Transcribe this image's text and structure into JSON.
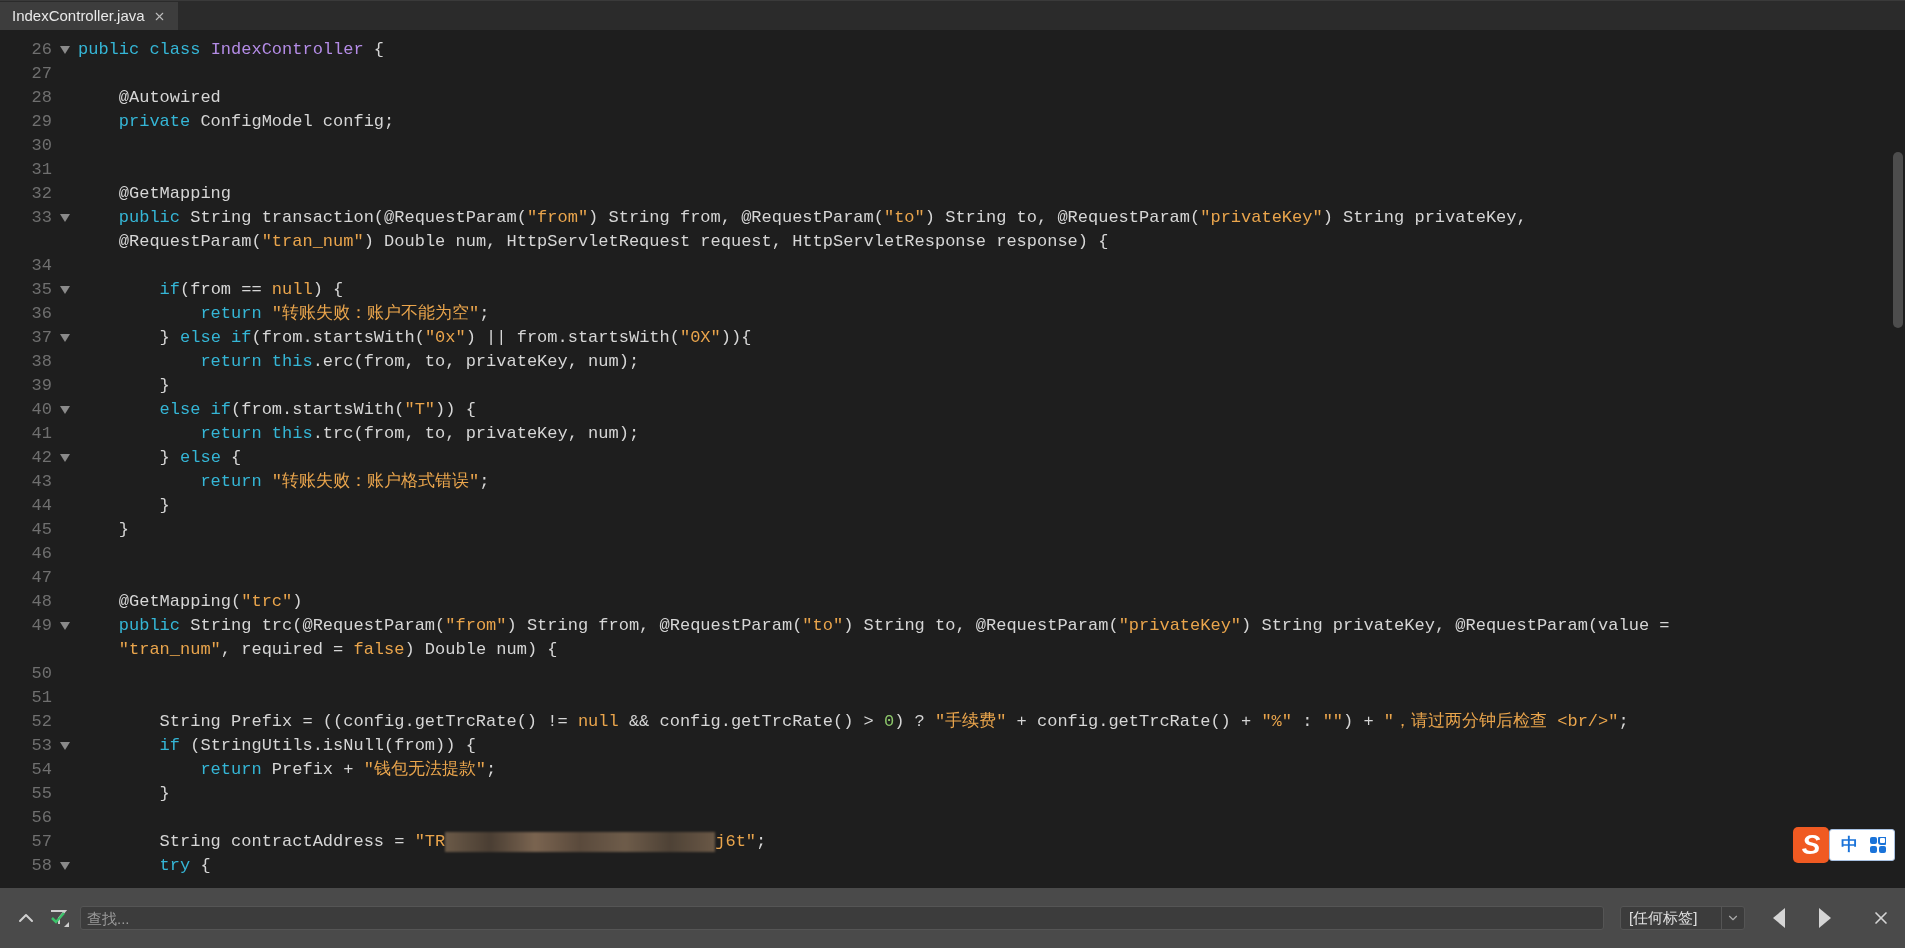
{
  "tabs": [
    {
      "label": "IndexController.java",
      "selected": true
    }
  ],
  "lines": [
    {
      "number": "26",
      "fold": true,
      "tokens": [
        {
          "kind": "keyword",
          "text": "public"
        },
        {
          "kind": "keyword",
          "text": " class"
        },
        {
          "kind": "class-name",
          "text": " IndexController"
        },
        {
          "kind": "plain",
          "text": " {"
        }
      ]
    },
    {
      "number": "27",
      "fold": false
    },
    {
      "number": "28",
      "fold": false,
      "tokens": [
        {
          "kind": "plain",
          "text": "    @Autowired"
        }
      ]
    },
    {
      "number": "29",
      "fold": false,
      "tokens": [
        {
          "kind": "keyword",
          "text": "    private"
        },
        {
          "kind": "plain",
          "text": " ConfigModel config;"
        }
      ]
    },
    {
      "number": "30",
      "fold": false
    },
    {
      "number": "31",
      "fold": false
    },
    {
      "number": "32",
      "fold": false,
      "tokens": [
        {
          "kind": "plain",
          "text": "    @GetMapping"
        }
      ]
    },
    {
      "number": "33",
      "fold": true,
      "tokens": [
        {
          "kind": "keyword",
          "text": "    public"
        },
        {
          "kind": "plain",
          "text": " String transaction(@RequestParam("
        },
        {
          "kind": "string",
          "text": "\"from\""
        },
        {
          "kind": "plain",
          "text": ") String from, @RequestParam("
        },
        {
          "kind": "string",
          "text": "\"to\""
        },
        {
          "kind": "plain",
          "text": ") String to, @RequestParam("
        },
        {
          "kind": "string",
          "text": "\"privateKey\""
        },
        {
          "kind": "plain",
          "text": ") String privateKey,"
        }
      ]
    },
    {
      "fold": false,
      "tokens": [
        {
          "kind": "plain",
          "text": "    @RequestParam("
        },
        {
          "kind": "string",
          "text": "\"tran_num\""
        },
        {
          "kind": "plain",
          "text": ") Double num, HttpServletRequest request, HttpServletResponse response) {"
        }
      ]
    },
    {
      "number": "34",
      "fold": false
    },
    {
      "number": "35",
      "fold": true,
      "tokens": [
        {
          "kind": "keyword",
          "text": "        if"
        },
        {
          "kind": "plain",
          "text": "(from == "
        },
        {
          "kind": "literal",
          "text": "null"
        },
        {
          "kind": "plain",
          "text": ") {"
        }
      ]
    },
    {
      "number": "36",
      "fold": false,
      "tokens": [
        {
          "kind": "keyword",
          "text": "            return"
        },
        {
          "kind": "string",
          "text": " \"转账失败：账户不能为空\""
        },
        {
          "kind": "plain",
          "text": ";"
        }
      ]
    },
    {
      "number": "37",
      "fold": true,
      "tokens": [
        {
          "kind": "plain",
          "text": "        } "
        },
        {
          "kind": "keyword",
          "text": "else if"
        },
        {
          "kind": "plain",
          "text": "(from.startsWith("
        },
        {
          "kind": "string",
          "text": "\"0x\""
        },
        {
          "kind": "plain",
          "text": ") || from.startsWith("
        },
        {
          "kind": "string",
          "text": "\"0X\""
        },
        {
          "kind": "plain",
          "text": ")){"
        }
      ]
    },
    {
      "number": "38",
      "fold": false,
      "tokens": [
        {
          "kind": "keyword",
          "text": "            return this"
        },
        {
          "kind": "plain",
          "text": ".erc(from, to, privateKey, num);"
        }
      ]
    },
    {
      "number": "39",
      "fold": false,
      "tokens": [
        {
          "kind": "plain",
          "text": "        }"
        }
      ]
    },
    {
      "number": "40",
      "fold": true,
      "tokens": [
        {
          "kind": "keyword",
          "text": "        else if"
        },
        {
          "kind": "plain",
          "text": "(from.startsWith("
        },
        {
          "kind": "string",
          "text": "\"T\""
        },
        {
          "kind": "plain",
          "text": ")) {"
        }
      ]
    },
    {
      "number": "41",
      "fold": false,
      "tokens": [
        {
          "kind": "keyword",
          "text": "            return this"
        },
        {
          "kind": "plain",
          "text": ".trc(from, to, privateKey, num);"
        }
      ]
    },
    {
      "number": "42",
      "fold": true,
      "tokens": [
        {
          "kind": "plain",
          "text": "        } "
        },
        {
          "kind": "keyword",
          "text": "else"
        },
        {
          "kind": "plain",
          "text": " {"
        }
      ]
    },
    {
      "number": "43",
      "fold": false,
      "tokens": [
        {
          "kind": "keyword",
          "text": "            return"
        },
        {
          "kind": "string",
          "text": " \"转账失败：账户格式错误\""
        },
        {
          "kind": "plain",
          "text": ";"
        }
      ]
    },
    {
      "number": "44",
      "fold": false,
      "tokens": [
        {
          "kind": "plain",
          "text": "        }"
        }
      ]
    },
    {
      "number": "45",
      "fold": false,
      "tokens": [
        {
          "kind": "plain",
          "text": "    }"
        }
      ]
    },
    {
      "number": "46",
      "fold": false
    },
    {
      "number": "47",
      "fold": false
    },
    {
      "number": "48",
      "fold": false,
      "tokens": [
        {
          "kind": "plain",
          "text": "    @GetMapping("
        },
        {
          "kind": "string",
          "text": "\"trc\""
        },
        {
          "kind": "plain",
          "text": ")"
        }
      ]
    },
    {
      "number": "49",
      "fold": true,
      "tokens": [
        {
          "kind": "keyword",
          "text": "    public"
        },
        {
          "kind": "plain",
          "text": " String trc(@RequestParam("
        },
        {
          "kind": "string",
          "text": "\"from\""
        },
        {
          "kind": "plain",
          "text": ") String from, @RequestParam("
        },
        {
          "kind": "string",
          "text": "\"to\""
        },
        {
          "kind": "plain",
          "text": ") String to, @RequestParam("
        },
        {
          "kind": "string",
          "text": "\"privateKey\""
        },
        {
          "kind": "plain",
          "text": ") String privateKey, @RequestParam(value ="
        }
      ]
    },
    {
      "fold": false,
      "tokens": [
        {
          "kind": "string",
          "text": "    \"tran_num\""
        },
        {
          "kind": "plain",
          "text": ", required = "
        },
        {
          "kind": "literal",
          "text": "false"
        },
        {
          "kind": "plain",
          "text": ") Double num) {"
        }
      ]
    },
    {
      "number": "50",
      "fold": false
    },
    {
      "number": "51",
      "fold": false
    },
    {
      "number": "52",
      "fold": false,
      "tokens": [
        {
          "kind": "plain",
          "text": "        String Prefix = ((config.getTrcRate() != "
        },
        {
          "kind": "literal",
          "text": "null"
        },
        {
          "kind": "plain",
          "text": " && config.getTrcRate() > "
        },
        {
          "kind": "number",
          "text": "0"
        },
        {
          "kind": "plain",
          "text": ") ? "
        },
        {
          "kind": "string",
          "text": "\"手续费\""
        },
        {
          "kind": "plain",
          "text": " + config.getTrcRate() + "
        },
        {
          "kind": "string",
          "text": "\"%\""
        },
        {
          "kind": "plain",
          "text": " : "
        },
        {
          "kind": "string",
          "text": "\"\""
        },
        {
          "kind": "plain",
          "text": ") + "
        },
        {
          "kind": "string",
          "text": "\"，请过两分钟后检查 <br/>\""
        },
        {
          "kind": "plain",
          "text": ";"
        }
      ]
    },
    {
      "number": "53",
      "fold": true,
      "tokens": [
        {
          "kind": "keyword",
          "text": "        if"
        },
        {
          "kind": "plain",
          "text": " (StringUtils.isNull(from)) {"
        }
      ]
    },
    {
      "number": "54",
      "fold": false,
      "tokens": [
        {
          "kind": "keyword",
          "text": "            return"
        },
        {
          "kind": "plain",
          "text": " Prefix + "
        },
        {
          "kind": "string",
          "text": "\"钱包无法提款\""
        },
        {
          "kind": "plain",
          "text": ";"
        }
      ]
    },
    {
      "number": "55",
      "fold": false,
      "tokens": [
        {
          "kind": "plain",
          "text": "        }"
        }
      ]
    },
    {
      "number": "56",
      "fold": false
    },
    {
      "number": "57",
      "fold": false,
      "tokens": [
        {
          "kind": "plain",
          "text": "        String contractAddress = "
        },
        {
          "kind": "string",
          "text": "\"TR"
        },
        {
          "kind": "redacted"
        },
        {
          "kind": "string",
          "text": "j6t\""
        },
        {
          "kind": "plain",
          "text": ";"
        }
      ]
    },
    {
      "number": "58",
      "fold": true,
      "tokens": [
        {
          "kind": "keyword",
          "text": "        try"
        },
        {
          "kind": "plain",
          "text": " {"
        }
      ]
    }
  ],
  "find_bar": {
    "placeholder": "查找...",
    "tag_filter": "[任何标签]"
  },
  "ime": {
    "logo": "S",
    "label": "中"
  }
}
